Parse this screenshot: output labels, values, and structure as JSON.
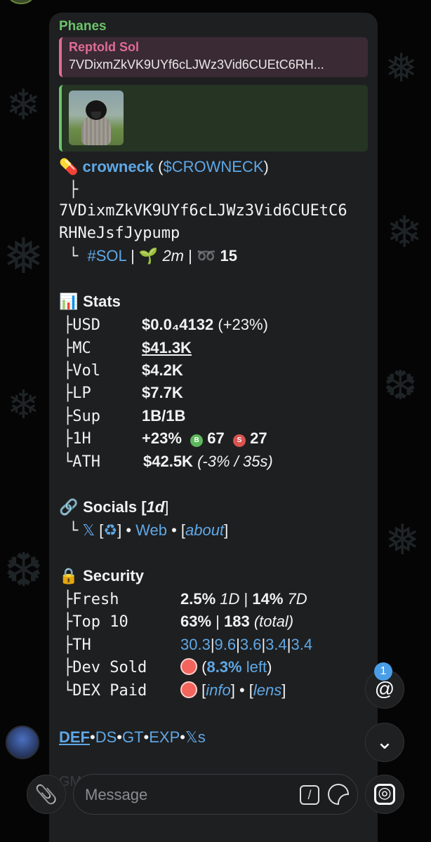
{
  "message": {
    "sender": "Phanes",
    "reply": {
      "title": "Reptold Sol",
      "text": "7VDixmZkVK9UYf6cLJWz3Vid6CUEtC6RH..."
    },
    "token": {
      "emoji": "💊",
      "name": "crowneck",
      "ticker_open": " (",
      "ticker": "$CROWNECK",
      "ticker_close": ")",
      "branch": "├",
      "address_line1": "7VDixmZkVK9UYf6cLJWz3Vid6CUEtC6",
      "address_line2": "RHNeJsfJypump",
      "chain": "#SOL",
      "sep": " | ",
      "age_emoji": "🌱",
      "age": "2m",
      "holders_emoji": "➿",
      "holders": "15"
    },
    "stats": {
      "emoji": "📊",
      "heading": "Stats",
      "rows": [
        {
          "branch": "├",
          "label": "USD",
          "value": "$0.0₄4132",
          "extra": " (+23%)"
        },
        {
          "branch": "├",
          "label": "MC",
          "value": "$41.3K",
          "extra": ""
        },
        {
          "branch": "├",
          "label": "Vol",
          "value": "$4.2K",
          "extra": ""
        },
        {
          "branch": "├",
          "label": "LP",
          "value": "$7.7K",
          "extra": ""
        },
        {
          "branch": "├",
          "label": "Sup",
          "value": "1B/1B",
          "extra": ""
        },
        {
          "branch": "├",
          "label": "1H",
          "value": "+23%",
          "extra": ""
        },
        {
          "branch": "└",
          "label": "ATH",
          "value": "$42.5K",
          "extra": " (-3% / 35s)"
        }
      ],
      "buys_letter": "B",
      "buys": "67",
      "sells_letter": "S",
      "sells": "27"
    },
    "socials": {
      "emoji": "🔗",
      "heading": "Socials [",
      "age": "1d",
      "close": "]",
      "branch": "└",
      "x": "𝕏",
      "x_open": " [",
      "recycle": "♻",
      "x_close": "]",
      "dot": " • ",
      "web": "Web",
      "about_open": "[",
      "about": "about",
      "about_close": "]"
    },
    "security": {
      "emoji": "🔒",
      "heading": "Security",
      "fresh": {
        "branch": "├",
        "label": "Fresh",
        "v1": "2.5%",
        "p1": " 1D",
        "sep": " | ",
        "v2": "14%",
        "p2": " 7D"
      },
      "top10": {
        "branch": "├",
        "label": "Top 10",
        "v1": "63%",
        "sep": " | ",
        "v2": "183",
        "p2": " (total)"
      },
      "th": {
        "branch": "├",
        "label": "TH",
        "values": [
          "30.3",
          "9.6",
          "3.6",
          "3.4",
          "3.4"
        ],
        "sep": "|"
      },
      "dev_sold": {
        "branch": "├",
        "label": "Dev Sold",
        "open": " (",
        "pct": "8.3%",
        "left": " left",
        "close": ")"
      },
      "dex_paid": {
        "branch": "└",
        "label": "DEX Paid",
        "open": " [",
        "info": "info",
        "mid": "] • [",
        "lens": "lens",
        "close": "]"
      }
    },
    "links": {
      "def": "DEF",
      "dot": "•",
      "ds": "DS",
      "gt": "GT",
      "exp": "EXP",
      "xs": "𝕏s"
    },
    "faded_text": "GM"
  },
  "mention_badge": "1",
  "mention_icon": "@",
  "scroll_down_icon": "⌄",
  "composer": {
    "placeholder": "Message",
    "command_icon": "/",
    "attach_icon": "📎",
    "camera_icon": "◎"
  },
  "colors": {
    "accent_link": "#5fa8e6",
    "sender": "#6bc46a",
    "reply_accent": "#e06c94",
    "bubble": "#1e1f21"
  }
}
